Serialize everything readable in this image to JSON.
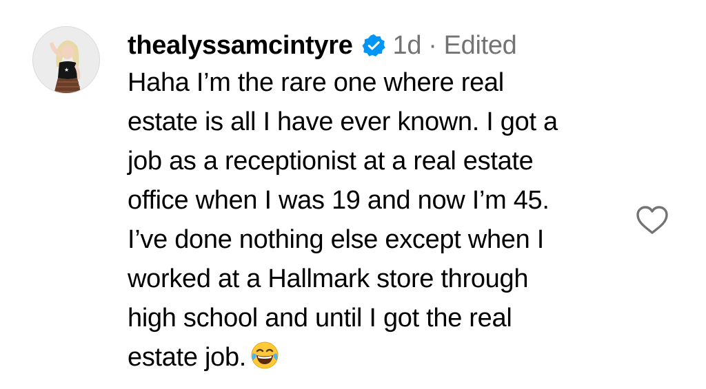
{
  "comment": {
    "username": "thealyssamcintyre",
    "verified": true,
    "time": "1d",
    "separator": "·",
    "edited": "Edited",
    "text": "Haha I’m the rare one where real\nestate is all I have ever known. I got a\njob as a receptionist at a real estate\noffice when I was 19 and now I’m 45.\nI’ve done nothing else except when I\nworked at a Hallmark store through\nhigh school and until I got the real\nestate job.",
    "emoji": "face-with-tears-of-joy",
    "like_icon": "heart-outline-icon"
  },
  "colors": {
    "text": "#000000",
    "meta": "#737373",
    "verified_badge": "#0095f6",
    "heart_outline": "#737373"
  }
}
